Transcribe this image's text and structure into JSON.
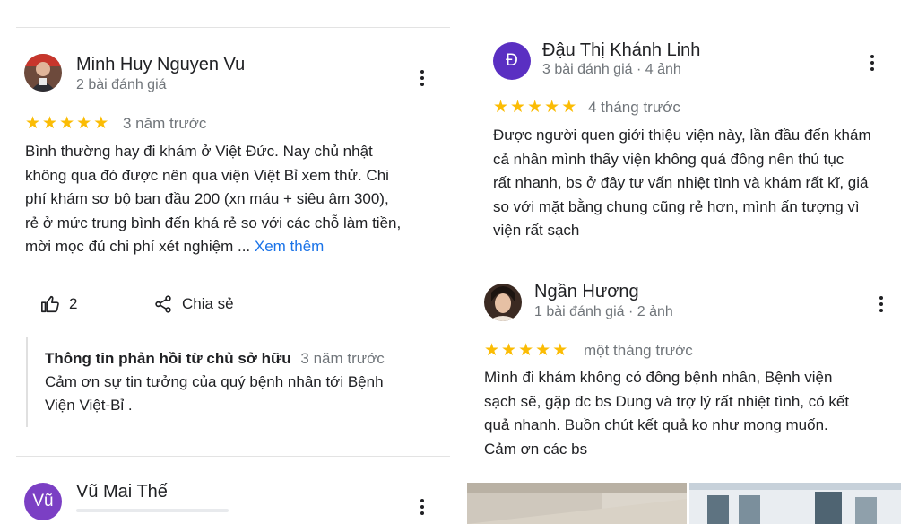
{
  "reviews": [
    {
      "name": "Minh Huy Nguyen Vu",
      "meta": "2 bài đánh giá",
      "rating": 5,
      "time": "3 năm trước",
      "text_lines": [
        "Bình thường hay đi khám ở Việt Đức. Nay chủ nhật",
        "không qua đó được nên qua viện Việt Bỉ xem thử. Chi",
        "phí khám sơ bộ ban đầu 200 (xn máu + siêu âm 300),",
        "rẻ ở mức trung bình đến khá rẻ so với các chỗ làm tiền,",
        "mời mọc đủ chi phí xét nghiệm ... "
      ],
      "more_label": "Xem thêm",
      "like_count": "2",
      "share_label": "Chia sẻ",
      "owner_reply": {
        "title": "Thông tin phản hồi từ chủ sở hữu",
        "time": "3 năm trước",
        "text_lines": [
          "Cảm ơn sự tin tưởng của quý bệnh nhân tới Bệnh",
          "Viện Việt-Bỉ ."
        ]
      }
    },
    {
      "name": "Vũ Mai Thế",
      "avatar_letter": "Vũ",
      "avatar_color": "#7b3fc4"
    },
    {
      "name": "Đậu Thị Khánh Linh",
      "avatar_letter": "Đ",
      "avatar_color": "#5a2fc2",
      "meta": "3 bài đánh giá · 4 ảnh",
      "rating": 5,
      "time": "4 tháng trước",
      "text_lines": [
        "Được người quen giới thiệu viện này, lần đầu đến khám",
        "cả nhân mình thấy viện không quá đông nên thủ tục",
        "rất nhanh, bs ở đây tư vấn nhiệt tình và khám rất kĩ, giá",
        "so với mặt bằng chung cũng rẻ hơn, mình ấn tượng vì",
        "viện rất sạch"
      ]
    },
    {
      "name": "Ngần Hương",
      "meta": "1 bài đánh giá · 2 ảnh",
      "rating": 5,
      "time": "một tháng trước",
      "text_lines": [
        "Mình đi khám không có đông bệnh nhân, Bệnh viện",
        "sạch sẽ, gặp đc bs Dung và trợ lý rất nhiệt tình, có kết",
        "quả nhanh. Buồn chút kết quả ko như mong muốn.",
        "Cảm ơn các bs"
      ]
    }
  ],
  "colors": {
    "star": "#fbbc04",
    "link": "#1a73e8",
    "muted": "#70757a"
  },
  "icons": {
    "like": "thumbs-up-icon",
    "share": "share-icon",
    "more": "more-vert-icon",
    "star": "star-icon"
  }
}
